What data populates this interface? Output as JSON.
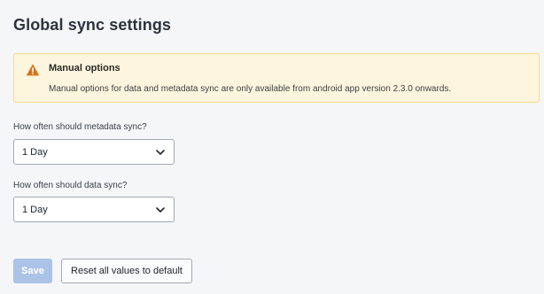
{
  "page": {
    "title": "Global sync settings"
  },
  "notice": {
    "title": "Manual options",
    "text": "Manual options for data and metadata sync are only available from android app version 2.3.0 onwards.",
    "icon": "warning-icon",
    "accent_color": "#d9711c"
  },
  "metadata_sync": {
    "label": "How often should metadata sync?",
    "value": "1 Day"
  },
  "data_sync": {
    "label": "How often should data sync?",
    "value": "1 Day"
  },
  "actions": {
    "save_label": "Save",
    "reset_label": "Reset all values to default"
  },
  "colors": {
    "primary_disabled": "#abc3e6",
    "warning_background": "#fdf5dd"
  }
}
